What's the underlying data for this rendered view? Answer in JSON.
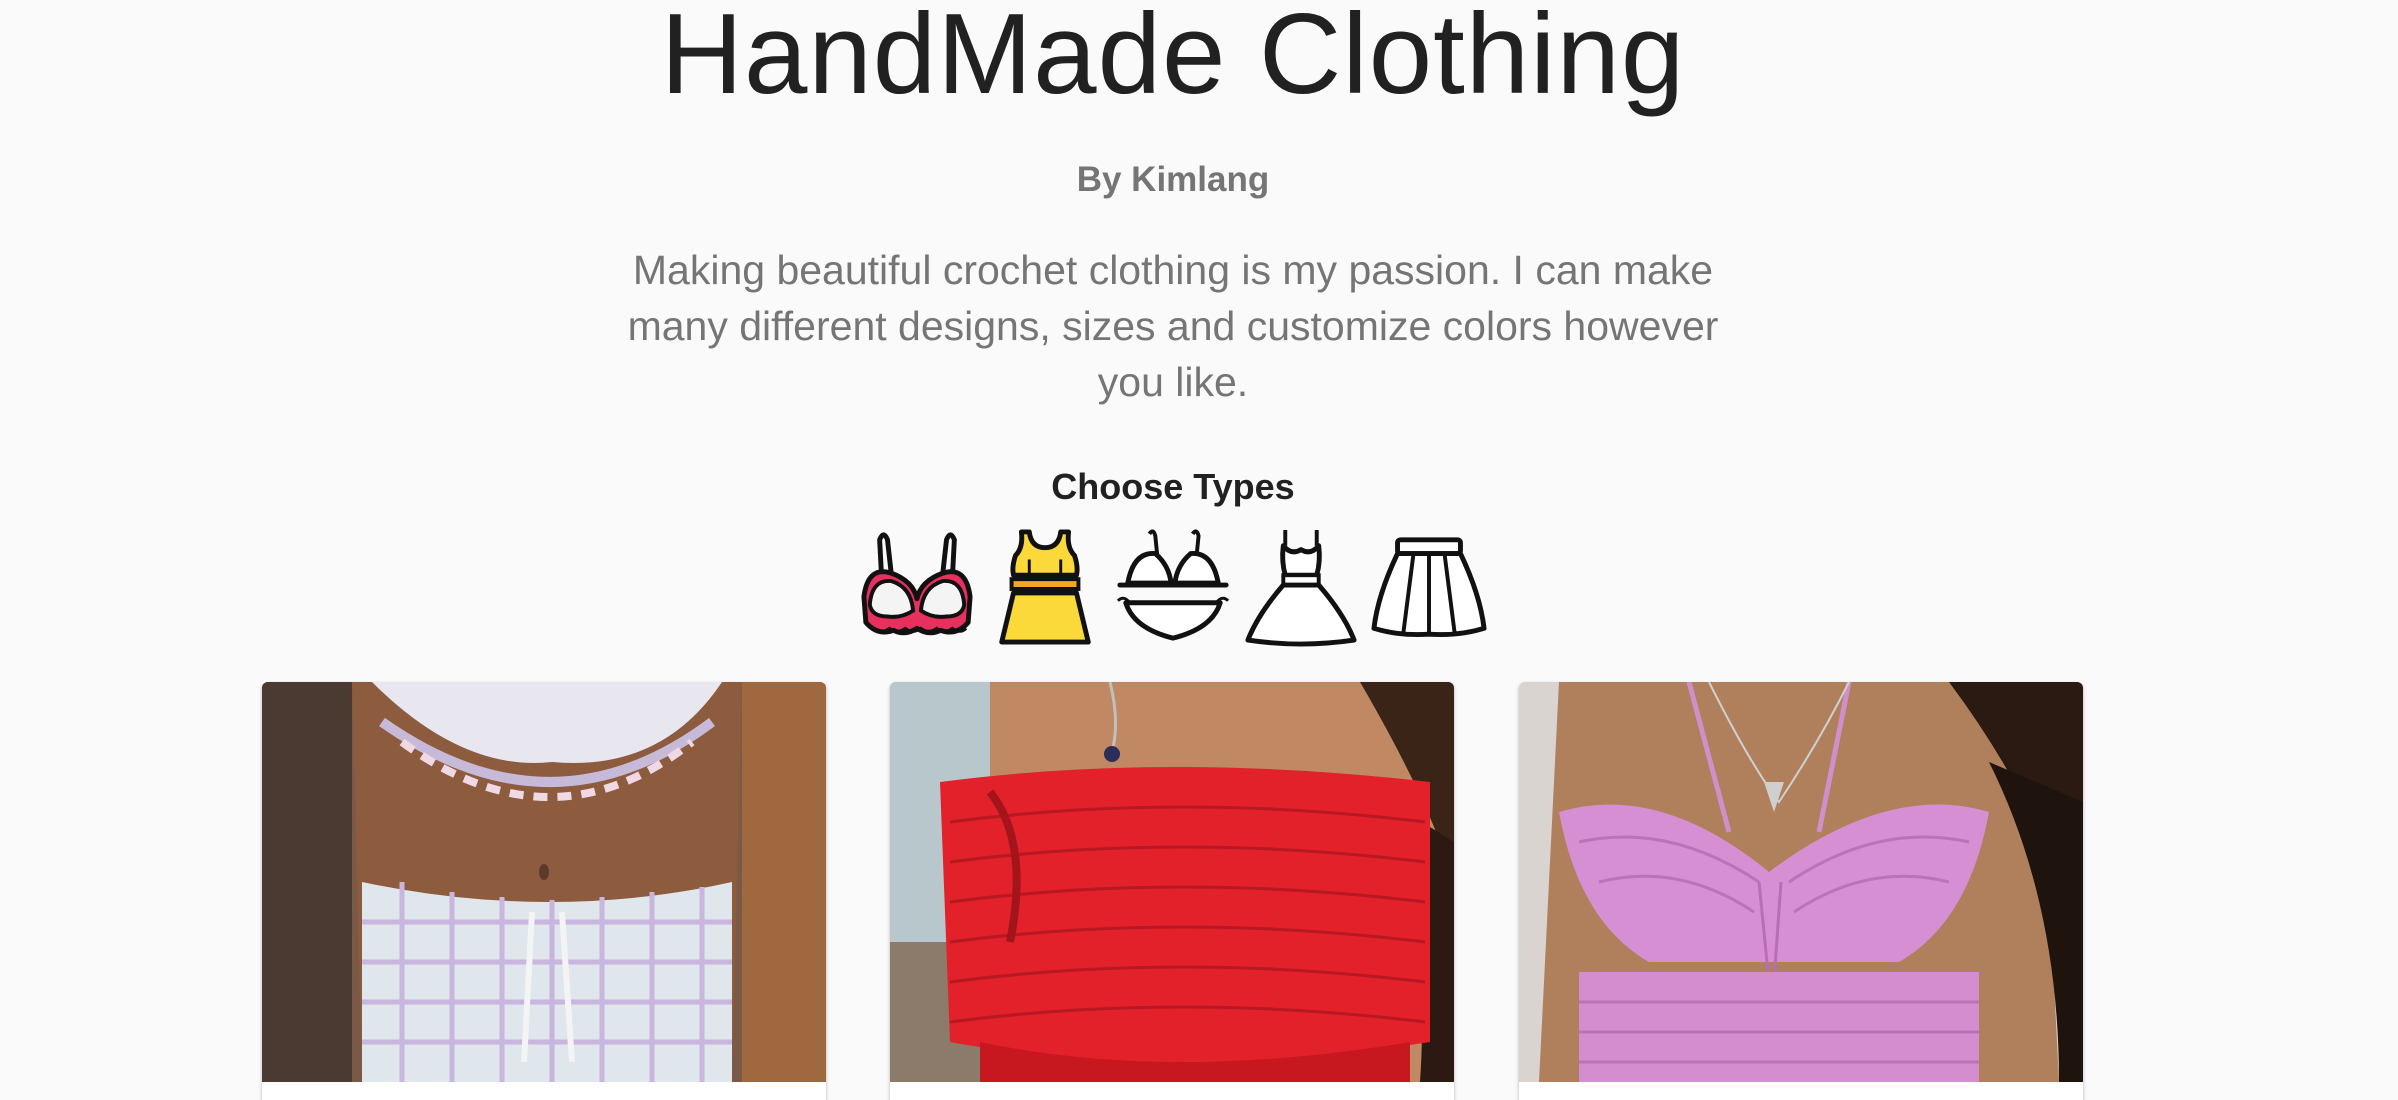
{
  "header": {
    "title": "HandMade Clothing",
    "byline": "By Kimlang",
    "description": "Making beautiful crochet clothing is my passion. I can make many different designs, sizes and customize colors however you like."
  },
  "types": {
    "heading": "Choose Types",
    "items": [
      {
        "icon": "bra-icon",
        "color": "#e8305e"
      },
      {
        "icon": "crop-top-set-icon",
        "color": "#fbd93a"
      },
      {
        "icon": "bikini-icon",
        "color": "#ffffff"
      },
      {
        "icon": "dress-icon",
        "color": "#ffffff"
      },
      {
        "icon": "skirt-icon",
        "color": "#ffffff"
      }
    ]
  },
  "products": [
    {
      "image": "pastel-crochet-top-and-shorts-photo"
    },
    {
      "image": "red-crochet-bandeau-top-photo"
    },
    {
      "image": "pink-crochet-halter-top-photo"
    }
  ]
}
